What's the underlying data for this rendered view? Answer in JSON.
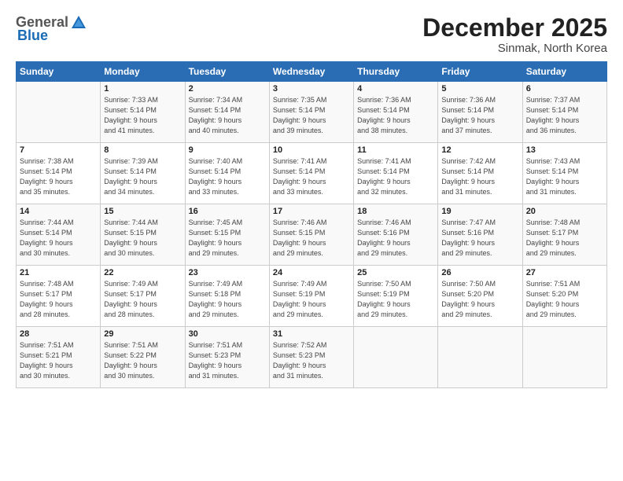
{
  "logo": {
    "general": "General",
    "blue": "Blue"
  },
  "title": "December 2025",
  "subtitle": "Sinmak, North Korea",
  "days": [
    "Sunday",
    "Monday",
    "Tuesday",
    "Wednesday",
    "Thursday",
    "Friday",
    "Saturday"
  ],
  "weeks": [
    [
      {
        "day": "",
        "info": ""
      },
      {
        "day": "1",
        "info": "Sunrise: 7:33 AM\nSunset: 5:14 PM\nDaylight: 9 hours\nand 41 minutes."
      },
      {
        "day": "2",
        "info": "Sunrise: 7:34 AM\nSunset: 5:14 PM\nDaylight: 9 hours\nand 40 minutes."
      },
      {
        "day": "3",
        "info": "Sunrise: 7:35 AM\nSunset: 5:14 PM\nDaylight: 9 hours\nand 39 minutes."
      },
      {
        "day": "4",
        "info": "Sunrise: 7:36 AM\nSunset: 5:14 PM\nDaylight: 9 hours\nand 38 minutes."
      },
      {
        "day": "5",
        "info": "Sunrise: 7:36 AM\nSunset: 5:14 PM\nDaylight: 9 hours\nand 37 minutes."
      },
      {
        "day": "6",
        "info": "Sunrise: 7:37 AM\nSunset: 5:14 PM\nDaylight: 9 hours\nand 36 minutes."
      }
    ],
    [
      {
        "day": "7",
        "info": "Sunrise: 7:38 AM\nSunset: 5:14 PM\nDaylight: 9 hours\nand 35 minutes."
      },
      {
        "day": "8",
        "info": "Sunrise: 7:39 AM\nSunset: 5:14 PM\nDaylight: 9 hours\nand 34 minutes."
      },
      {
        "day": "9",
        "info": "Sunrise: 7:40 AM\nSunset: 5:14 PM\nDaylight: 9 hours\nand 33 minutes."
      },
      {
        "day": "10",
        "info": "Sunrise: 7:41 AM\nSunset: 5:14 PM\nDaylight: 9 hours\nand 33 minutes."
      },
      {
        "day": "11",
        "info": "Sunrise: 7:41 AM\nSunset: 5:14 PM\nDaylight: 9 hours\nand 32 minutes."
      },
      {
        "day": "12",
        "info": "Sunrise: 7:42 AM\nSunset: 5:14 PM\nDaylight: 9 hours\nand 31 minutes."
      },
      {
        "day": "13",
        "info": "Sunrise: 7:43 AM\nSunset: 5:14 PM\nDaylight: 9 hours\nand 31 minutes."
      }
    ],
    [
      {
        "day": "14",
        "info": "Sunrise: 7:44 AM\nSunset: 5:14 PM\nDaylight: 9 hours\nand 30 minutes."
      },
      {
        "day": "15",
        "info": "Sunrise: 7:44 AM\nSunset: 5:15 PM\nDaylight: 9 hours\nand 30 minutes."
      },
      {
        "day": "16",
        "info": "Sunrise: 7:45 AM\nSunset: 5:15 PM\nDaylight: 9 hours\nand 29 minutes."
      },
      {
        "day": "17",
        "info": "Sunrise: 7:46 AM\nSunset: 5:15 PM\nDaylight: 9 hours\nand 29 minutes."
      },
      {
        "day": "18",
        "info": "Sunrise: 7:46 AM\nSunset: 5:16 PM\nDaylight: 9 hours\nand 29 minutes."
      },
      {
        "day": "19",
        "info": "Sunrise: 7:47 AM\nSunset: 5:16 PM\nDaylight: 9 hours\nand 29 minutes."
      },
      {
        "day": "20",
        "info": "Sunrise: 7:48 AM\nSunset: 5:17 PM\nDaylight: 9 hours\nand 29 minutes."
      }
    ],
    [
      {
        "day": "21",
        "info": "Sunrise: 7:48 AM\nSunset: 5:17 PM\nDaylight: 9 hours\nand 28 minutes."
      },
      {
        "day": "22",
        "info": "Sunrise: 7:49 AM\nSunset: 5:17 PM\nDaylight: 9 hours\nand 28 minutes."
      },
      {
        "day": "23",
        "info": "Sunrise: 7:49 AM\nSunset: 5:18 PM\nDaylight: 9 hours\nand 29 minutes."
      },
      {
        "day": "24",
        "info": "Sunrise: 7:49 AM\nSunset: 5:19 PM\nDaylight: 9 hours\nand 29 minutes."
      },
      {
        "day": "25",
        "info": "Sunrise: 7:50 AM\nSunset: 5:19 PM\nDaylight: 9 hours\nand 29 minutes."
      },
      {
        "day": "26",
        "info": "Sunrise: 7:50 AM\nSunset: 5:20 PM\nDaylight: 9 hours\nand 29 minutes."
      },
      {
        "day": "27",
        "info": "Sunrise: 7:51 AM\nSunset: 5:20 PM\nDaylight: 9 hours\nand 29 minutes."
      }
    ],
    [
      {
        "day": "28",
        "info": "Sunrise: 7:51 AM\nSunset: 5:21 PM\nDaylight: 9 hours\nand 30 minutes."
      },
      {
        "day": "29",
        "info": "Sunrise: 7:51 AM\nSunset: 5:22 PM\nDaylight: 9 hours\nand 30 minutes."
      },
      {
        "day": "30",
        "info": "Sunrise: 7:51 AM\nSunset: 5:23 PM\nDaylight: 9 hours\nand 31 minutes."
      },
      {
        "day": "31",
        "info": "Sunrise: 7:52 AM\nSunset: 5:23 PM\nDaylight: 9 hours\nand 31 minutes."
      },
      {
        "day": "",
        "info": ""
      },
      {
        "day": "",
        "info": ""
      },
      {
        "day": "",
        "info": ""
      }
    ]
  ]
}
